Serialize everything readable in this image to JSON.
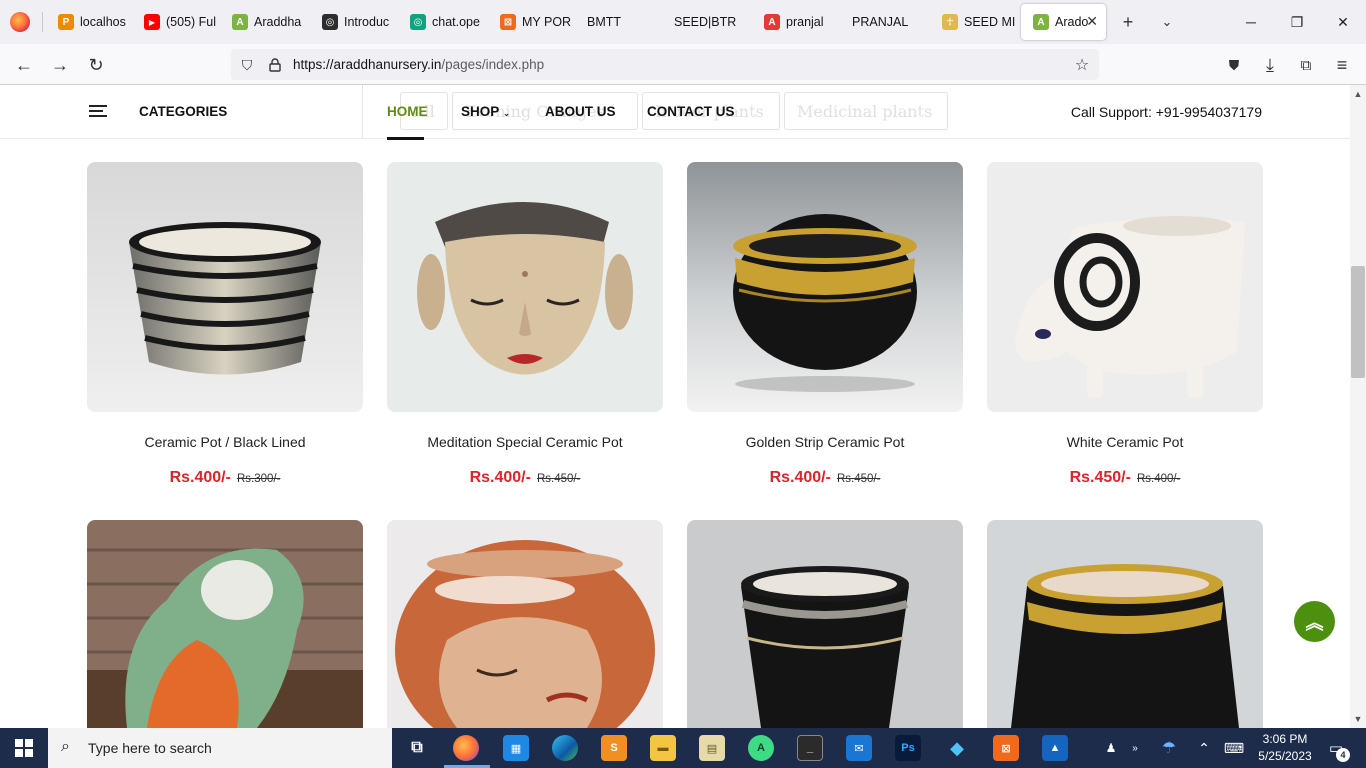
{
  "browser": {
    "tabs": [
      {
        "label": "localhos",
        "fav_color": "#f08a00",
        "fav_text": "P"
      },
      {
        "label": "(505) Ful",
        "fav_color": "#ff0000",
        "fav_text": "▶"
      },
      {
        "label": "Araddha",
        "fav_color": "#7cb342",
        "fav_text": "A"
      },
      {
        "label": "Introduc",
        "fav_color": "#2d2d2d",
        "fav_text": "◎"
      },
      {
        "label": "chat.ope",
        "fav_color": "#10a37f",
        "fav_text": "◎"
      },
      {
        "label": "MY POR",
        "fav_color": "#f06a1d",
        "fav_text": "⊠"
      },
      {
        "label": "BMTT",
        "fav_color": "",
        "fav_text": ""
      },
      {
        "label": "SEED|BTR",
        "fav_color": "",
        "fav_text": ""
      },
      {
        "label": "pranjal",
        "fav_color": "#e53935",
        "fav_text": "A"
      },
      {
        "label": "PRANJAL",
        "fav_color": "",
        "fav_text": ""
      },
      {
        "label": "SEED MI",
        "fav_color": "#e0b84b",
        "fav_text": "☥"
      },
      {
        "label": "Arado",
        "fav_color": "#7cb342",
        "fav_text": "A"
      }
    ],
    "url_host": "https://araddhanursery.in",
    "url_path": "/pages/index.php"
  },
  "header": {
    "categories_label": "CATEGORIES",
    "ghost_filters": [
      "All",
      "Evening Oranges",
      "Indoor plants",
      "Medicinal plants"
    ],
    "menu": [
      "HOME",
      "SHOP",
      "ABOUT US",
      "CONTACT US"
    ],
    "support": "Call Support: +91-9954037179"
  },
  "products": [
    {
      "name": "Ceramic Pot / Black Lined",
      "price": "Rs.400/-",
      "old_price": "Rs.300/-"
    },
    {
      "name": "Meditation Special Ceramic Pot",
      "price": "Rs.400/-",
      "old_price": "Rs.450/-"
    },
    {
      "name": "Golden Strip Ceramic Pot",
      "price": "Rs.400/-",
      "old_price": "Rs.450/-"
    },
    {
      "name": "White Ceramic Pot",
      "price": "Rs.450/-",
      "old_price": "Rs.400/-"
    }
  ],
  "taskbar": {
    "search_placeholder": "Type here to search",
    "time": "3:06 PM",
    "date": "5/25/2023",
    "notification_count": "4"
  },
  "colors": {
    "accent_green": "#5f8b15",
    "price_red": "#d8262c",
    "back_top": "#4d8f0f"
  }
}
